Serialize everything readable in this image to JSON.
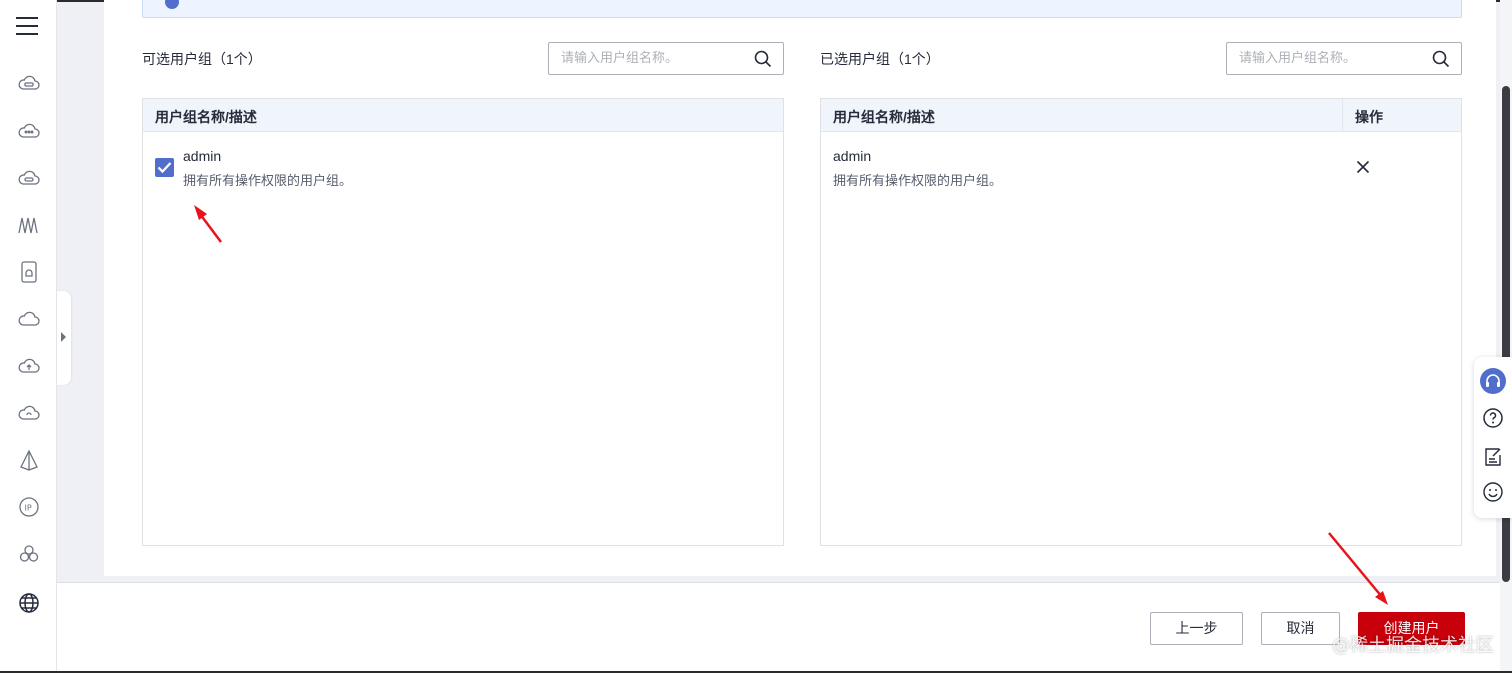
{
  "sidebar": {
    "icons": [
      "menu-icon",
      "cloud-server-icon",
      "cloud-dots-icon",
      "cloud-database-icon",
      "waveform-icon",
      "device-icon",
      "cloud-icon",
      "cloud-upload-icon",
      "cloud-refresh-icon",
      "triangle-icon",
      "ip-icon",
      "cluster-icon",
      "globe-icon"
    ]
  },
  "available": {
    "title": "可选用户组（1个）",
    "search_placeholder": "请输入用户组名称。",
    "column_header": "用户组名称/描述",
    "rows": [
      {
        "name": "admin",
        "description": "拥有所有操作权限的用户组。",
        "checked": true
      }
    ]
  },
  "selected": {
    "title": "已选用户组（1个）",
    "search_placeholder": "请输入用户组名称。",
    "column_header": "用户组名称/描述",
    "action_header": "操作",
    "rows": [
      {
        "name": "admin",
        "description": "拥有所有操作权限的用户组。"
      }
    ]
  },
  "footer": {
    "prev_label": "上一步",
    "cancel_label": "取消",
    "create_label": "创建用户"
  },
  "watermark": "@稀土掘金技术社区",
  "colors": {
    "accent": "#526ecc",
    "primary_button": "#c7000b",
    "annotation_arrow": "#e8131b",
    "table_header_bg": "#f0f5fc"
  }
}
